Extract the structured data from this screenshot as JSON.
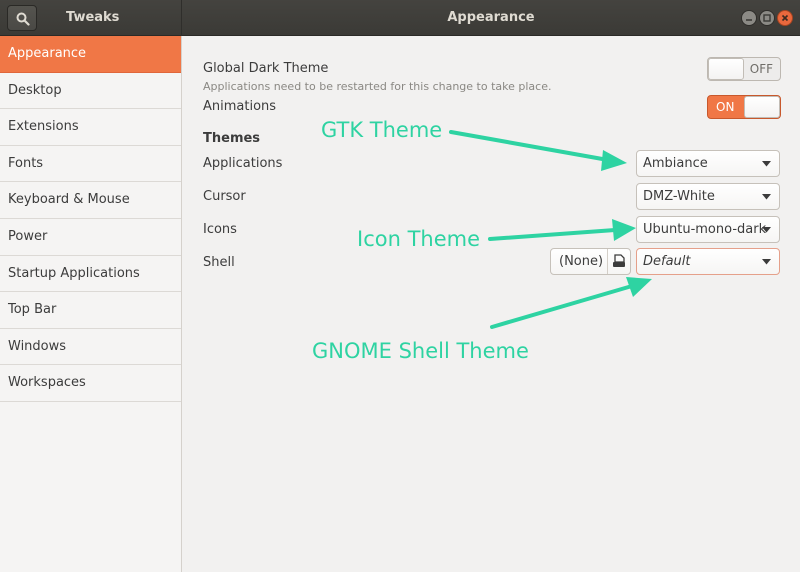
{
  "header": {
    "app_title": "Tweaks",
    "page_title": "Appearance",
    "search_icon": "search-icon",
    "window_controls": [
      "minimize-icon",
      "maximize-icon",
      "close-icon"
    ]
  },
  "sidebar": {
    "items": [
      {
        "label": "Appearance",
        "active": true
      },
      {
        "label": "Desktop"
      },
      {
        "label": "Extensions"
      },
      {
        "label": "Fonts"
      },
      {
        "label": "Keyboard & Mouse"
      },
      {
        "label": "Power"
      },
      {
        "label": "Startup Applications"
      },
      {
        "label": "Top Bar"
      },
      {
        "label": "Windows"
      },
      {
        "label": "Workspaces"
      }
    ]
  },
  "main": {
    "global_dark_theme": {
      "label": "Global Dark Theme",
      "note": "Applications need to be restarted for this change to take place.",
      "state": "OFF"
    },
    "animations": {
      "label": "Animations",
      "state": "ON"
    },
    "themes": {
      "heading": "Themes",
      "applications": {
        "label": "Applications",
        "value": "Ambiance"
      },
      "cursor": {
        "label": "Cursor",
        "value": "DMZ-White"
      },
      "icons": {
        "label": "Icons",
        "value": "Ubuntu-mono-dark"
      },
      "shell": {
        "label": "Shell",
        "file_button": "(None)",
        "value": "Default"
      }
    }
  },
  "annotations": {
    "gtk": "GTK Theme",
    "icon": "Icon Theme",
    "shell": "GNOME Shell Theme",
    "color": "#2ed3a2"
  },
  "colors": {
    "accent": "#f07746",
    "headerbar": "#3f3e3a",
    "background": "#f2f1f0"
  }
}
